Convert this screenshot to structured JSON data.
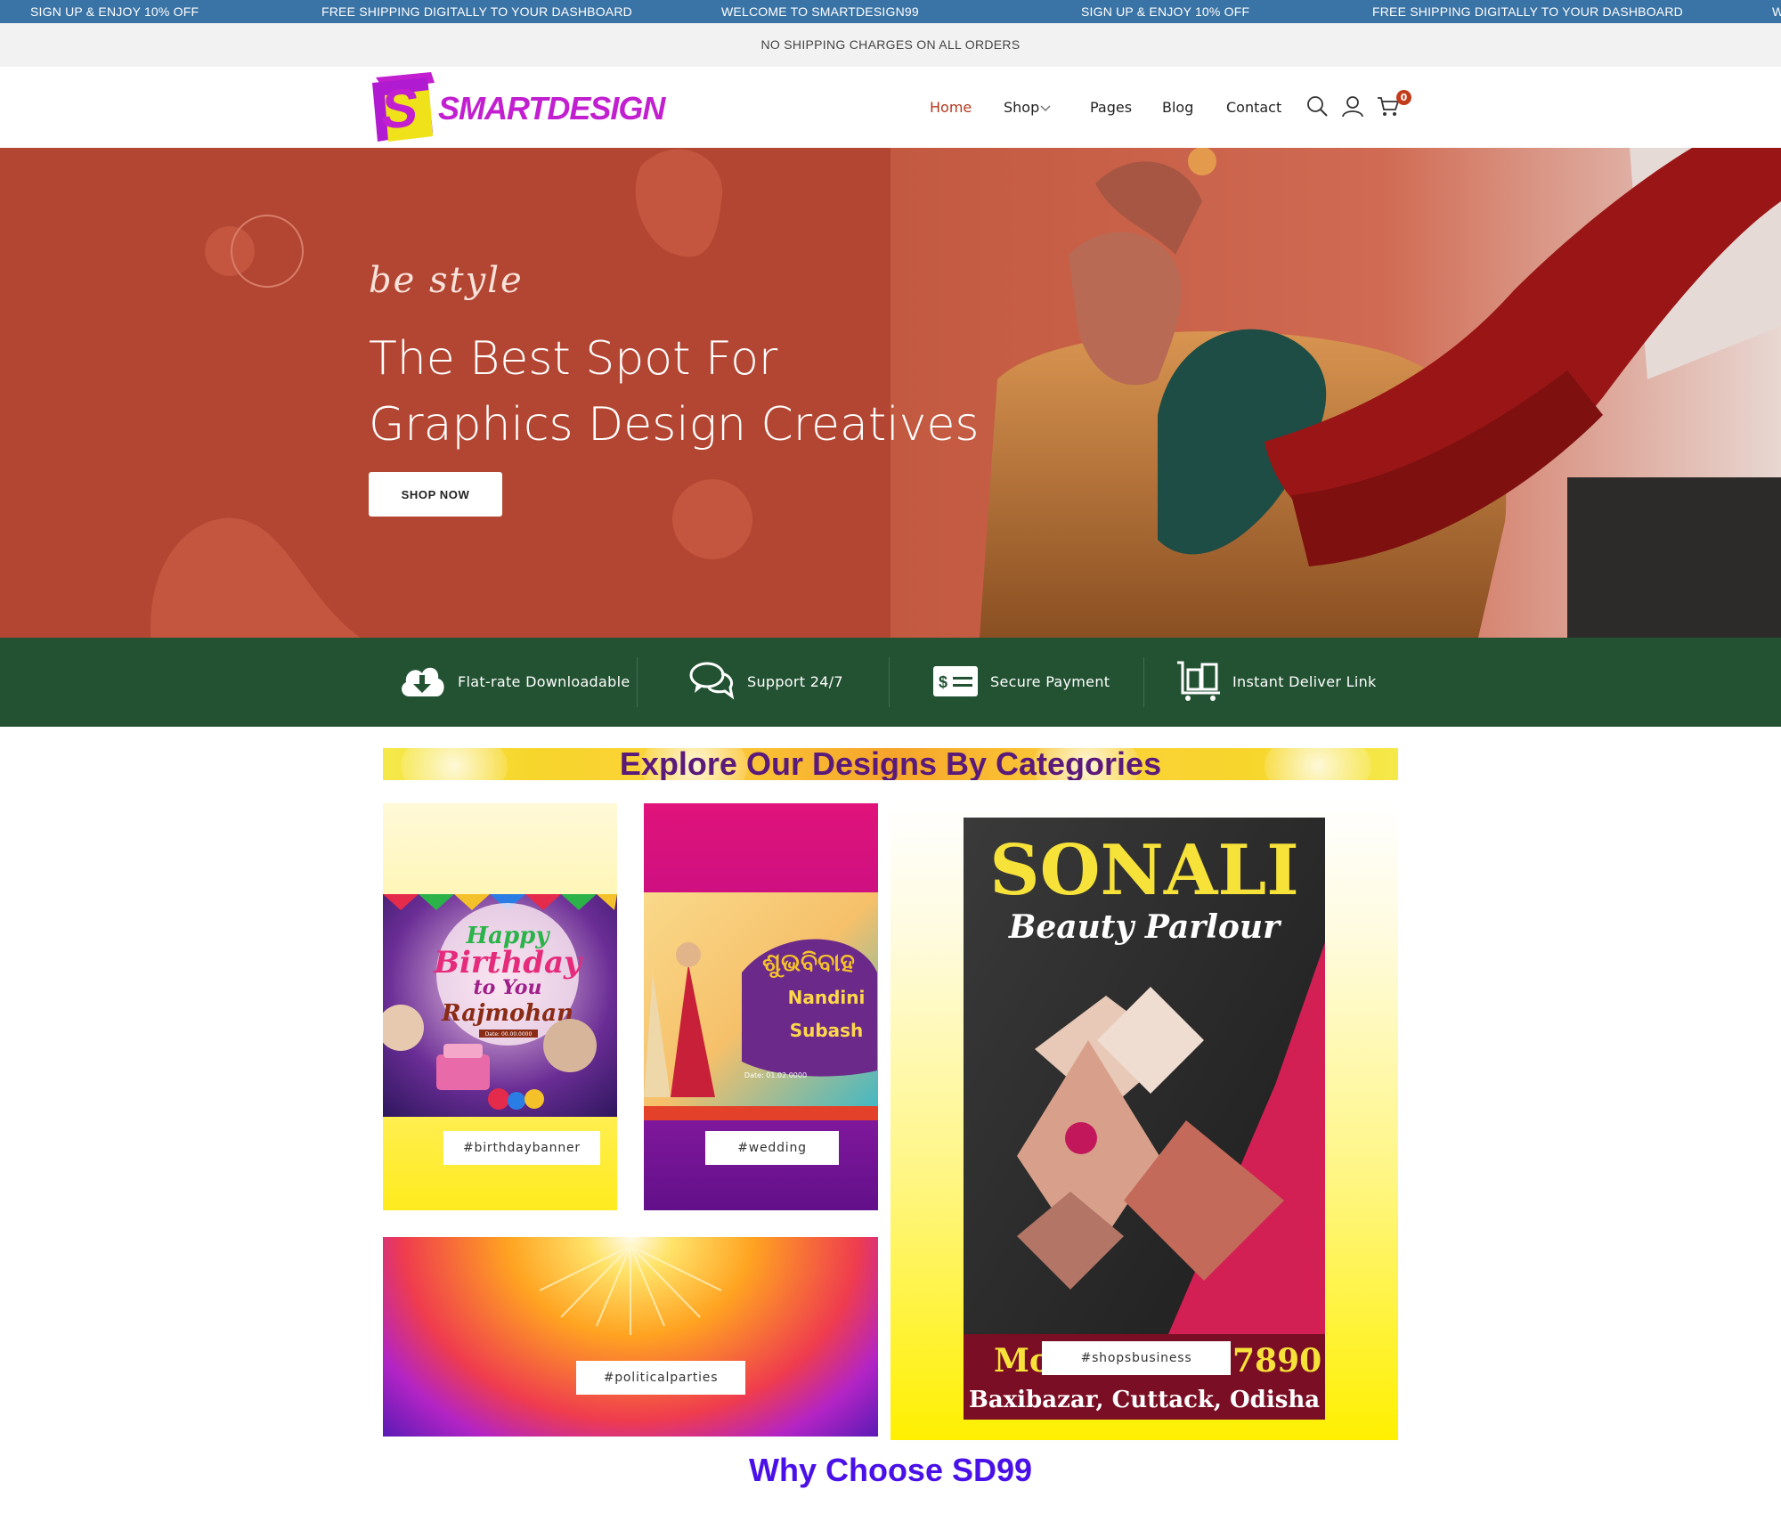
{
  "marquee": {
    "items": [
      "SIGN UP & ENJOY 10% OFF",
      "FREE SHIPPING DIGITALLY TO YOUR DASHBOARD",
      "WELCOME TO SMARTDESIGN99",
      "SIGN UP & ENJOY 10% OFF",
      "FREE SHIPPING DIGITALLY TO YOUR DASHBOARD",
      "W"
    ]
  },
  "notice": "NO SHIPPING CHARGES ON ALL ORDERS",
  "header": {
    "logo_text": "SMARTDESIGN",
    "nav": [
      "Home",
      "Shop",
      "Pages",
      "Blog",
      "Contact"
    ],
    "cart_count": "0",
    "icons": [
      "search-icon",
      "user-icon",
      "cart-icon",
      "chevron-down-icon"
    ]
  },
  "hero": {
    "script": "be style",
    "title_line1": "The Best Spot For",
    "title_line2": "Graphics Design Creatives",
    "button": "SHOP NOW"
  },
  "features": [
    {
      "icon": "cloud-download-icon",
      "label": "Flat-rate Downloadable"
    },
    {
      "icon": "chat-bubbles-icon",
      "label": "Support 24/7"
    },
    {
      "icon": "payment-card-icon",
      "label": "Secure Payment"
    },
    {
      "icon": "luggage-cart-icon",
      "label": "Instant Deliver Link"
    }
  ],
  "categories": {
    "title": "Explore Our Designs By Categories",
    "tiles": [
      {
        "tag": "#birthdaybanner",
        "art": {
          "line1": "Happy",
          "line2": "Birthday",
          "line3": "to You",
          "name": "Rajmohan",
          "date": "Date: 00.00.0000"
        }
      },
      {
        "tag": "#wedding",
        "art": {
          "title": "ଶୁଭବିବାହ",
          "name1": "Nandini",
          "name2": "Subash",
          "date": "Date: 01.02.0000"
        }
      },
      {
        "tag": "#politicalparties"
      },
      {
        "tag": "#shopsbusiness",
        "art": {
          "brand": "SONALI",
          "subtitle": "Beauty Parlour",
          "mobile_left": "Mo",
          "mobile_right": "7890",
          "address": "Baxibazar, Cuttack, Odisha"
        }
      }
    ]
  },
  "why_title": "Why Choose SD99",
  "colors": {
    "marquee_bg": "#3a73a6",
    "hero_bg": "#b34632",
    "features_bg": "#235233",
    "accent": "#b5391f",
    "why_title": "#4a10e8"
  }
}
